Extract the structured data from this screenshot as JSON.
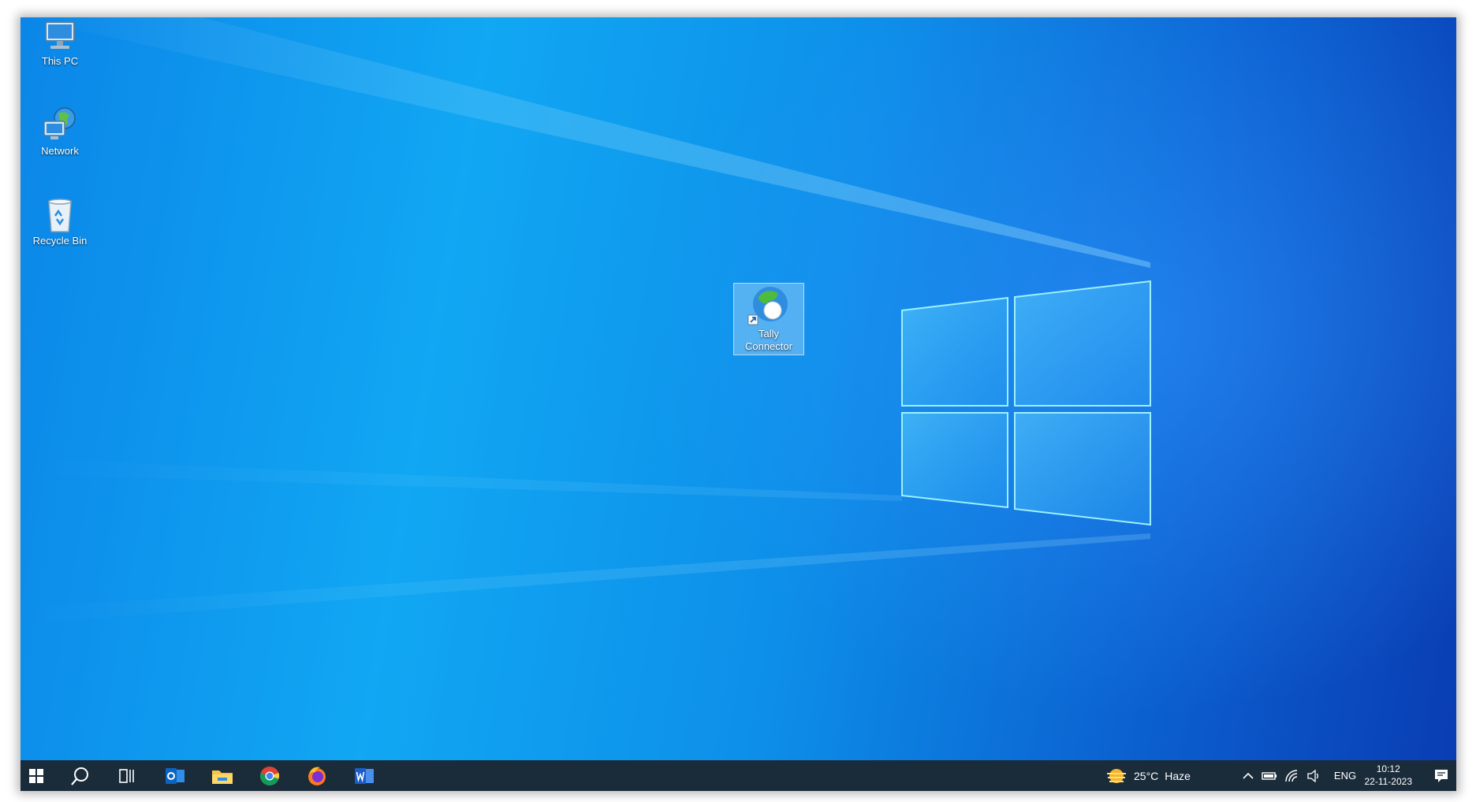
{
  "desktop": {
    "icons": [
      {
        "label": "This PC",
        "icon": "computer-icon"
      },
      {
        "label": "Network",
        "icon": "network-icon"
      },
      {
        "label": "Recycle Bin",
        "icon": "recycle-bin-icon"
      }
    ],
    "shortcut": {
      "label_line1": "Tally",
      "label_line2": "Connector",
      "icon": "tally-connector-icon"
    }
  },
  "taskbar": {
    "apps": [
      {
        "name": "start",
        "icon": "windows-icon"
      },
      {
        "name": "search",
        "icon": "search-icon"
      },
      {
        "name": "task-view",
        "icon": "task-view-icon"
      },
      {
        "name": "outlook",
        "icon": "outlook-icon"
      },
      {
        "name": "file-explorer",
        "icon": "folder-icon"
      },
      {
        "name": "chrome",
        "icon": "chrome-icon"
      },
      {
        "name": "firefox",
        "icon": "firefox-icon"
      },
      {
        "name": "word",
        "icon": "word-icon"
      }
    ],
    "weather": {
      "temp": "25°C",
      "condition": "Haze",
      "icon": "weather-sun-icon"
    },
    "tray": {
      "language": "ENG"
    },
    "clock": {
      "time": "10:12",
      "date": "22-11-2023"
    }
  },
  "colors": {
    "taskbar": "#1a2b3a",
    "wallpaper_blue": "#0b86e8",
    "accent_light": "#7fe3ff"
  }
}
